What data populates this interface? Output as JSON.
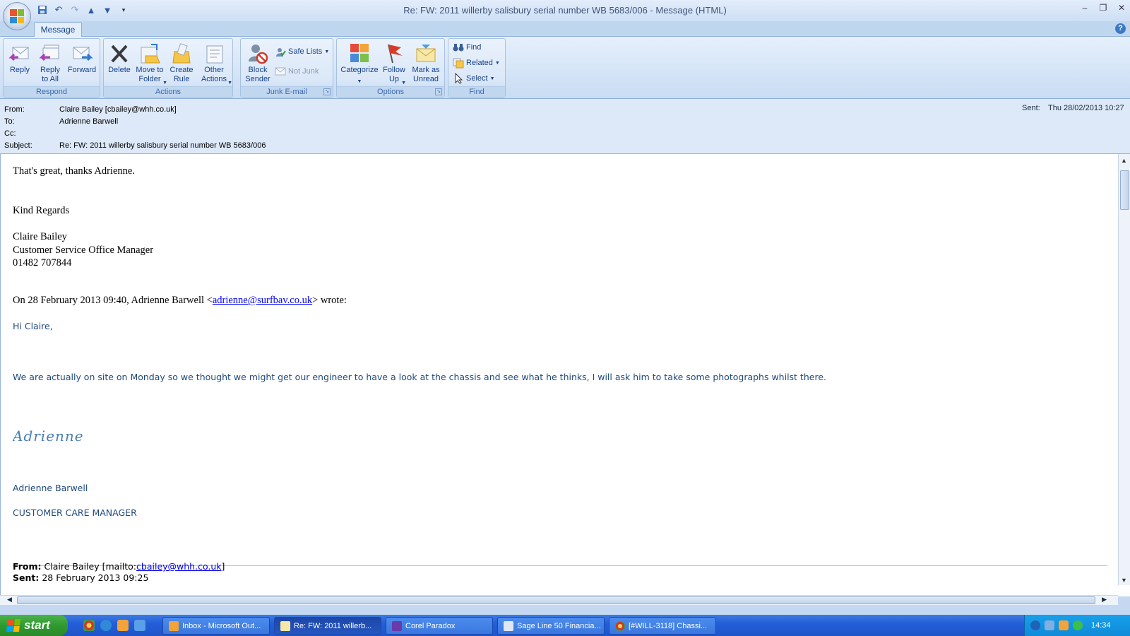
{
  "window": {
    "title": "Re: FW: 2011 willerby salisbury serial number WB 5683/006 - Message (HTML)",
    "minimize_glyph": "–",
    "restore_glyph": "❐",
    "close_glyph": "✕"
  },
  "ribbon": {
    "tab": "Message",
    "groups": {
      "respond": {
        "label": "Respond",
        "reply": "Reply",
        "reply_all": "Reply to All",
        "forward": "Forward"
      },
      "actions": {
        "label": "Actions",
        "delete": "Delete",
        "move_to_folder": "Move to Folder",
        "create_rule": "Create Rule",
        "other_actions": "Other Actions"
      },
      "junk": {
        "label": "Junk E-mail",
        "block_sender": "Block Sender",
        "safe_lists": "Safe Lists",
        "not_junk": "Not Junk"
      },
      "options": {
        "label": "Options",
        "categorize": "Categorize",
        "follow_up": "Follow Up",
        "mark_unread": "Mark as Unread"
      },
      "find": {
        "label": "Find",
        "find": "Find",
        "related": "Related",
        "select": "Select"
      }
    }
  },
  "header": {
    "from_label": "From:",
    "from_value": "Claire Bailey [cbailey@whh.co.uk]",
    "to_label": "To:",
    "to_value": "Adrienne Barwell",
    "cc_label": "Cc:",
    "cc_value": "",
    "subject_label": "Subject:",
    "subject_value": "Re: FW: 2011 willerby salisbury serial number WB 5683/006",
    "sent_label": "Sent:",
    "sent_value": "Thu 28/02/2013 10:27"
  },
  "body": {
    "line1": "That's great, thanks Adrienne.",
    "regards": "Kind Regards",
    "sig_name": "Claire Bailey",
    "sig_title": "Customer Service Office Manager",
    "sig_phone": "01482 707844",
    "quote_intro_before": "On 28 February 2013 09:40, Adrienne Barwell <",
    "quote_intro_link": "adrienne@surfbav.co.uk",
    "quote_intro_after": "> wrote:",
    "greeting": "Hi Claire,",
    "paragraph": "We are actually on site on Monday so we thought we might get our engineer to have a look at the chassis and see what he thinks, I will ask him to take some photographs whilst there.",
    "signature_script": "Adrienne",
    "sender_name": "Adrienne Barwell",
    "sender_title": "CUSTOMER CARE MANAGER",
    "fwd_from_label": "From:",
    "fwd_from_text": "Claire Bailey [mailto:",
    "fwd_from_link": "cbailey@whh.co.uk",
    "fwd_from_close": "]",
    "fwd_sent_label": "Sent:",
    "fwd_sent_value": "28 February 2013 09:25"
  },
  "taskbar": {
    "start": "start",
    "tasks": [
      {
        "label": "Inbox - Microsoft Out...",
        "active": false
      },
      {
        "label": "Re: FW: 2011 willerb...",
        "active": true
      },
      {
        "label": "Corel Paradox",
        "active": false
      },
      {
        "label": "Sage Line 50 Financia...",
        "active": false
      },
      {
        "label": "[#WILL-3118] Chassi...",
        "active": false
      }
    ],
    "clock": "14:34"
  }
}
